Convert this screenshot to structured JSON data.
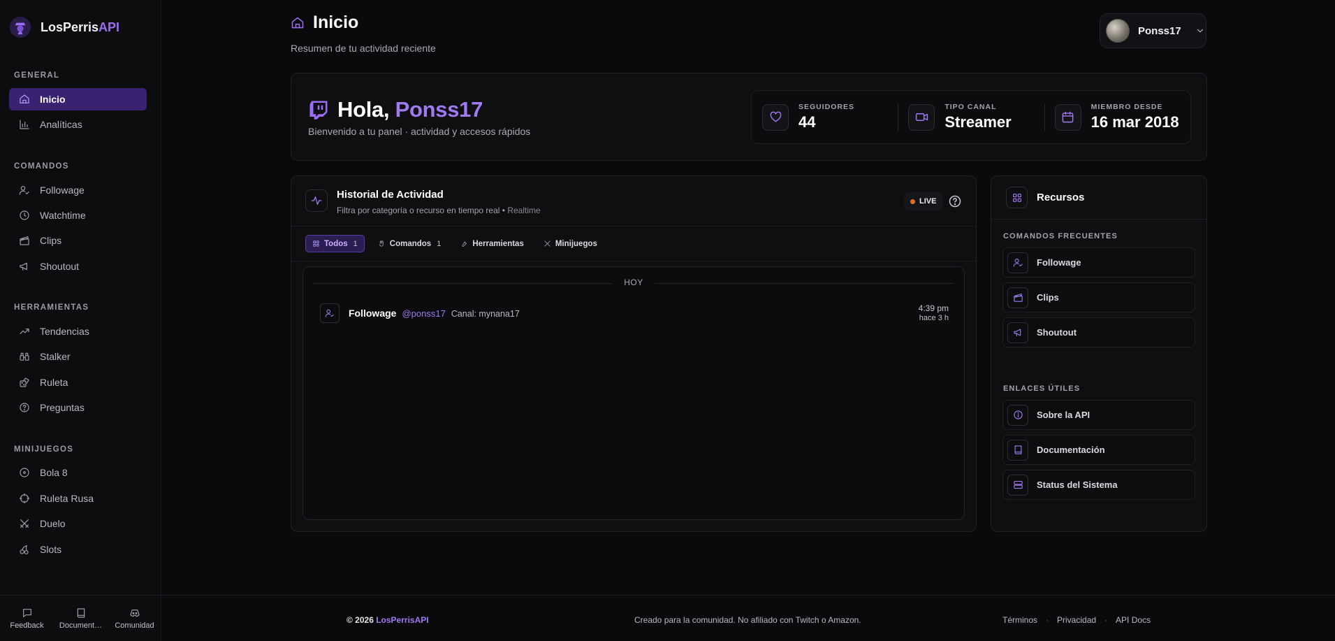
{
  "brand": {
    "name_main": "LosPerris",
    "name_accent": "API"
  },
  "sidebar": {
    "sections": [
      {
        "title": "GENERAL",
        "items": [
          {
            "label": "Inicio",
            "icon": "home-icon",
            "active": true
          },
          {
            "label": "Analíticas",
            "icon": "bar-chart-icon"
          }
        ]
      },
      {
        "title": "COMANDOS",
        "items": [
          {
            "label": "Followage",
            "icon": "user-check-icon"
          },
          {
            "label": "Watchtime",
            "icon": "clock-icon"
          },
          {
            "label": "Clips",
            "icon": "clapperboard-icon"
          },
          {
            "label": "Shoutout",
            "icon": "megaphone-icon"
          }
        ]
      },
      {
        "title": "HERRAMIENTAS",
        "items": [
          {
            "label": "Tendencias",
            "icon": "trending-up-icon"
          },
          {
            "label": "Stalker",
            "icon": "binoculars-icon"
          },
          {
            "label": "Ruleta",
            "icon": "dice-icon"
          },
          {
            "label": "Preguntas",
            "icon": "question-circle-icon"
          }
        ]
      },
      {
        "title": "MINIJUEGOS",
        "items": [
          {
            "label": "Bola 8",
            "icon": "eight-ball-icon"
          },
          {
            "label": "Ruleta Rusa",
            "icon": "crosshair-icon"
          },
          {
            "label": "Duelo",
            "icon": "swords-icon"
          },
          {
            "label": "Slots",
            "icon": "cherries-icon"
          }
        ]
      }
    ],
    "footer": [
      {
        "label": "Feedback",
        "icon": "message-square-icon"
      },
      {
        "label": "Document…",
        "icon": "book-icon"
      },
      {
        "label": "Comunidad",
        "icon": "discord-icon"
      }
    ]
  },
  "header": {
    "title": "Inicio",
    "subtitle": "Resumen de tu actividad reciente"
  },
  "user": {
    "name": "Ponss17"
  },
  "welcome": {
    "greeting": "Hola, ",
    "username": "Ponss17",
    "subtitle": "Bienvenido a tu panel · actividad y accesos rápidos",
    "stats": [
      {
        "label": "SEGUIDORES",
        "value": "44",
        "icon": "heart-icon"
      },
      {
        "label": "TIPO CANAL",
        "value": "Streamer",
        "icon": "video-icon"
      },
      {
        "label": "MIEMBRO DESDE",
        "value": "16 mar 2018",
        "icon": "calendar-icon"
      }
    ]
  },
  "activity": {
    "title": "Historial de Actividad",
    "subtitle": "Filtra por categoría o recurso en tiempo real • ",
    "subtitle_realtime": "Realtime",
    "live_label": "LIVE",
    "filters": [
      {
        "label": "Todos",
        "count": "1",
        "active": true,
        "icon": "grid-icon"
      },
      {
        "label": "Comandos",
        "count": "1",
        "icon": "hand-icon"
      },
      {
        "label": "Herramientas",
        "count": "",
        "icon": "wrench-icon"
      },
      {
        "label": "Minijuegos",
        "count": "",
        "icon": "swords-icon"
      }
    ],
    "day_label": "HOY",
    "events": [
      {
        "title": "Followage",
        "user": "@ponss17",
        "detail": "Canal: mynana17",
        "time": "4:39 pm",
        "ago": "hace 3 h"
      }
    ]
  },
  "resources": {
    "title": "Recursos",
    "frequent_title": "COMANDOS FRECUENTES",
    "frequent": [
      {
        "label": "Followage",
        "icon": "user-check-icon"
      },
      {
        "label": "Clips",
        "icon": "clapperboard-icon"
      },
      {
        "label": "Shoutout",
        "icon": "megaphone-icon"
      }
    ],
    "links_title": "ENLACES ÚTILES",
    "links": [
      {
        "label": "Sobre la API",
        "icon": "info-icon"
      },
      {
        "label": "Documentación",
        "icon": "book-icon"
      },
      {
        "label": "Status del Sistema",
        "icon": "server-icon"
      }
    ]
  },
  "footer": {
    "copyright": "© 2026 ",
    "brand": "LosPerrisAPI",
    "disclaimer": "Creado para la comunidad. No afiliado con Twitch o Amazon.",
    "links": [
      "Términos",
      "Privacidad",
      "API Docs"
    ],
    "separator": "·"
  },
  "colors": {
    "accent": "#9b6cf5",
    "background": "#0a0a0c",
    "live_dot": "#e0702a"
  }
}
